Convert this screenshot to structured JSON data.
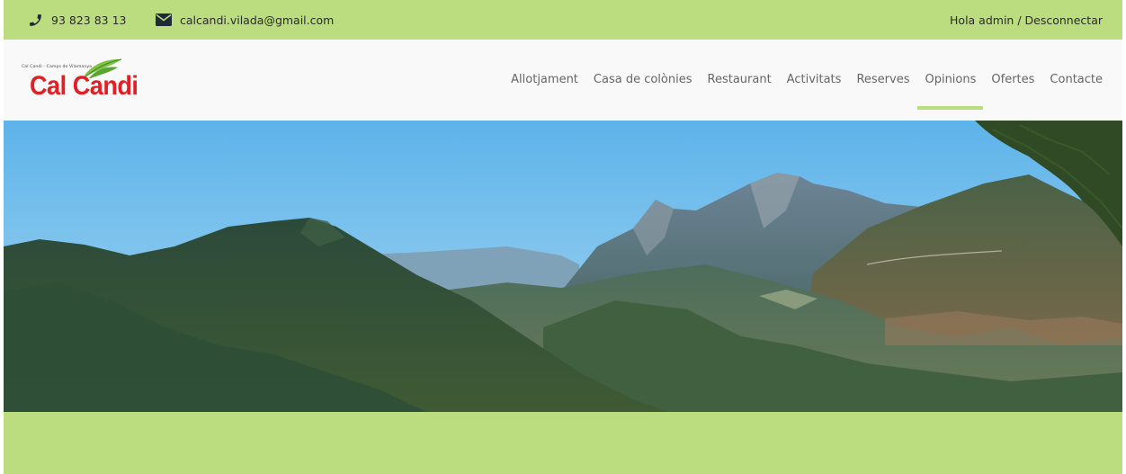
{
  "topbar": {
    "phone": "93 823 83 13",
    "email": "calcandi.vilada@gmail.com",
    "greeting": "Hola admin",
    "separator": " / ",
    "logout": "Desconnectar",
    "icons": {
      "phone": "phone-icon",
      "email": "envelope-icon"
    }
  },
  "logo": {
    "tagline": "Cal Candi - Camps de Vilamanya",
    "name": "Cal Candi"
  },
  "nav": {
    "items": [
      {
        "label": "Allotjament"
      },
      {
        "label": "Casa de colònies"
      },
      {
        "label": "Restaurant"
      },
      {
        "label": "Activitats"
      },
      {
        "label": "Reserves"
      },
      {
        "label": "Opinions",
        "active": true
      },
      {
        "label": "Ofertes"
      },
      {
        "label": "Contacte"
      }
    ]
  },
  "hero": {
    "image": "mountain-landscape"
  },
  "colors": {
    "accent_green": "#bbdd7f",
    "logo_red": "#e31e24",
    "nav_text": "#666666",
    "header_bg": "#f8f9f8"
  }
}
